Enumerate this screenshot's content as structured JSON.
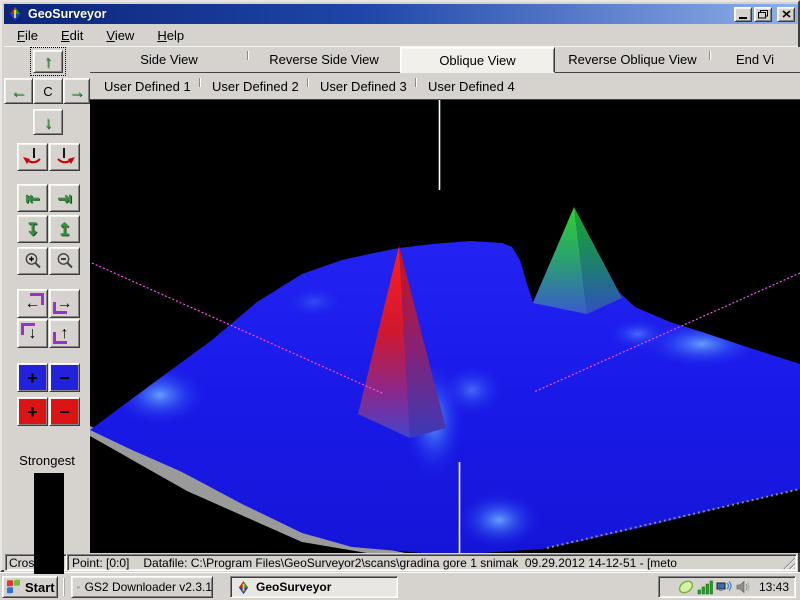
{
  "window": {
    "title": "GeoSurveyor",
    "controls": [
      "minimize",
      "restore",
      "close"
    ]
  },
  "menu": {
    "items": [
      {
        "label": "File"
      },
      {
        "label": "Edit"
      },
      {
        "label": "View"
      },
      {
        "label": "Help"
      }
    ]
  },
  "view_tabs": {
    "items": [
      {
        "label": "Side View",
        "selected": false
      },
      {
        "label": "Reverse Side View",
        "selected": false
      },
      {
        "label": "Oblique View",
        "selected": true
      },
      {
        "label": "Reverse Oblique View",
        "selected": false
      },
      {
        "label": "End Vi",
        "selected": false
      }
    ]
  },
  "user_tabs": {
    "items": [
      {
        "label": "User Defined 1"
      },
      {
        "label": "User Defined 2"
      },
      {
        "label": "User Defined 3"
      },
      {
        "label": "User Defined 4"
      }
    ]
  },
  "toolbar": {
    "center_button_label": "C",
    "strongest_label": "Strongest",
    "icons": [
      "up-arrow",
      "left-arrow",
      "right-arrow",
      "down-arrow",
      "rotate-left",
      "rotate-right",
      "skip-to-first",
      "skip-to-last",
      "skip-to-bottom",
      "skip-to-top",
      "zoom-in",
      "zoom-out",
      "pan-left",
      "pan-right",
      "pan-down",
      "pan-up",
      "blue-plus",
      "blue-minus",
      "red-plus",
      "red-minus"
    ],
    "scale_bar_color": "#000000"
  },
  "scene": {
    "background": "#000000",
    "surface_color": "#1c1cee",
    "peaks": [
      {
        "name": "center-peak",
        "color": "#ee1414"
      },
      {
        "name": "right-peak",
        "color": "#22cc33"
      }
    ],
    "marker_line_color": "#ff4cff",
    "crosshair_color": "#ffffff"
  },
  "status": {
    "left": "Cros",
    "point": "Point: [0:0]",
    "datafile": "Datafile: C:\\Program Files\\GeoSurveyor2\\scans\\gradina gore 1 snimak  09.29.2012 14-12-51 - [meto"
  },
  "taskbar": {
    "start_label": "Start",
    "tasks": [
      {
        "label": "GS2 Downloader v2.3.1",
        "active": false
      },
      {
        "label": "GeoSurveyor",
        "active": true
      }
    ],
    "tray": {
      "icons": [
        "leaf-icon",
        "signal-bars-icon",
        "network-icon",
        "volume-icon"
      ],
      "clock": "13:43"
    }
  }
}
